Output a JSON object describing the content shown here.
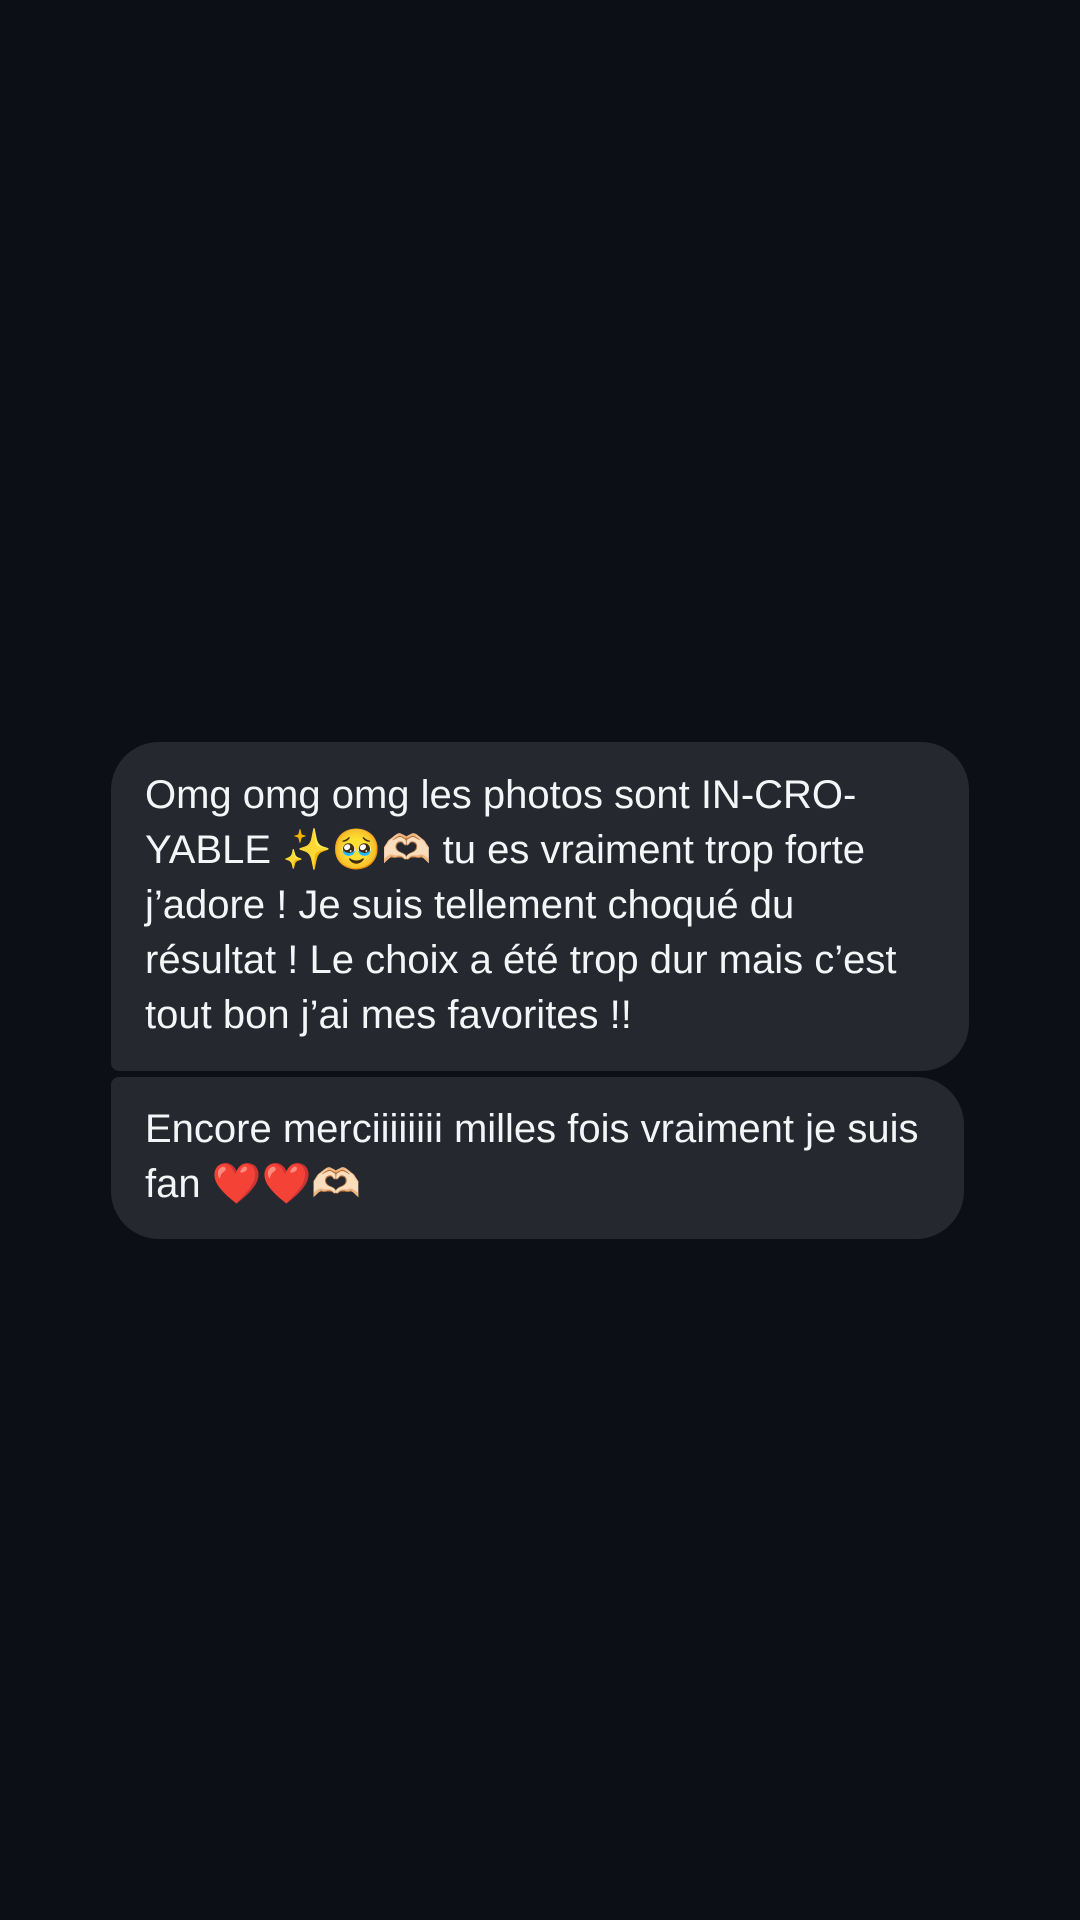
{
  "colors": {
    "background": "#0c0f16",
    "bubble": "#25282f",
    "text": "#f4f5f7"
  },
  "messages": [
    {
      "text": "Omg omg omg les photos sont IN-CRO-YABLE ✨🥹🫶🏻 tu es vraiment trop forte j’adore ! Je suis tellement choqué du résultat ! Le choix a été trop dur mais c’est tout bon j’ai mes favorites !!"
    },
    {
      "text": "Encore merciiiiiiii milles fois vraiment je suis fan ❤️❤️🫶🏻"
    }
  ]
}
